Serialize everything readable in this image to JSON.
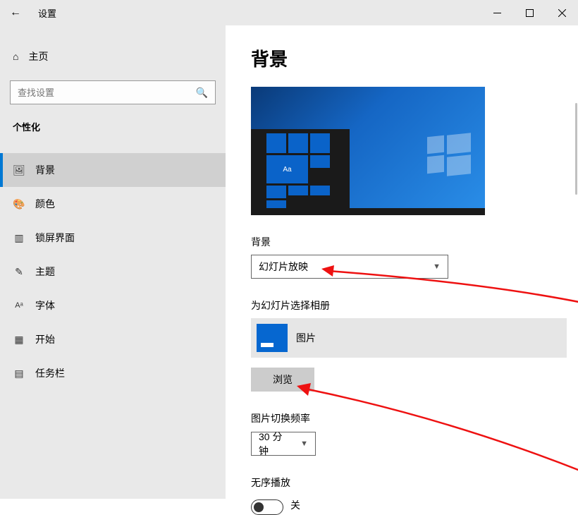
{
  "titlebar": {
    "title": "设置"
  },
  "sidebar": {
    "home": "主页",
    "search_placeholder": "查找设置",
    "section": "个性化",
    "items": [
      {
        "label": "背景"
      },
      {
        "label": "颜色"
      },
      {
        "label": "锁屏界面"
      },
      {
        "label": "主题"
      },
      {
        "label": "字体"
      },
      {
        "label": "开始"
      },
      {
        "label": "任务栏"
      }
    ]
  },
  "content": {
    "page_title": "背景",
    "preview_tile_text": "Aa",
    "bg_label": "背景",
    "bg_value": "幻灯片放映",
    "album_label": "为幻灯片选择相册",
    "album_name": "图片",
    "browse": "浏览",
    "interval_label": "图片切换频率",
    "interval_value": "30 分钟",
    "shuffle_label": "无序播放",
    "shuffle_state": "关"
  }
}
